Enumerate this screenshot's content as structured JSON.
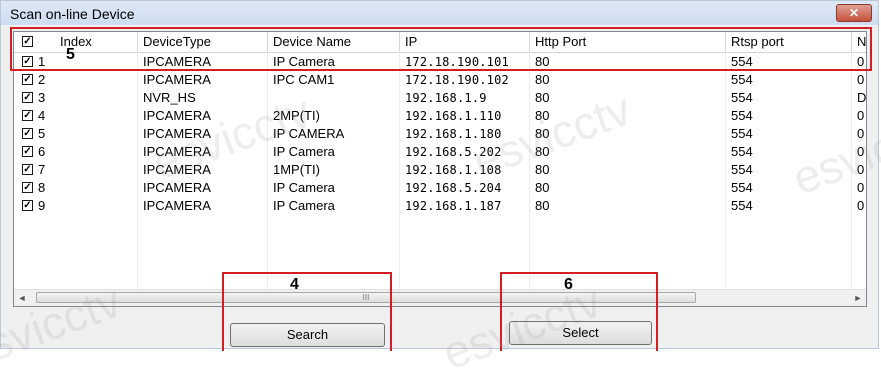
{
  "window": {
    "title": "Scan on-line Device",
    "close_glyph": "✕"
  },
  "columns": [
    "Index",
    "DeviceType",
    "Device Name",
    "IP",
    "Http Port",
    "Rtsp port",
    "N"
  ],
  "header_checked": true,
  "rows": [
    {
      "index": "1",
      "type": "IPCAMERA",
      "name": "IP Camera",
      "ip": "172.18.190.101",
      "http": "80",
      "rtsp": "554",
      "n": "0"
    },
    {
      "index": "2",
      "type": "IPCAMERA",
      "name": "IPC CAM1",
      "ip": "172.18.190.102",
      "http": "80",
      "rtsp": "554",
      "n": "0"
    },
    {
      "index": "3",
      "type": "NVR_HS",
      "name": "",
      "ip": "192.168.1.9",
      "http": "80",
      "rtsp": "554",
      "n": "D"
    },
    {
      "index": "4",
      "type": "IPCAMERA",
      "name": "2MP(TI)",
      "ip": "192.168.1.110",
      "http": "80",
      "rtsp": "554",
      "n": "0"
    },
    {
      "index": "5",
      "type": "IPCAMERA",
      "name": "IP CAMERA",
      "ip": "192.168.1.180",
      "http": "80",
      "rtsp": "554",
      "n": "0"
    },
    {
      "index": "6",
      "type": "IPCAMERA",
      "name": "IP Camera",
      "ip": "192.168.5.202",
      "http": "80",
      "rtsp": "554",
      "n": "0"
    },
    {
      "index": "7",
      "type": "IPCAMERA",
      "name": "1MP(TI)",
      "ip": "192.168.1.108",
      "http": "80",
      "rtsp": "554",
      "n": "0"
    },
    {
      "index": "8",
      "type": "IPCAMERA",
      "name": "IP Camera",
      "ip": "192.168.5.204",
      "http": "80",
      "rtsp": "554",
      "n": "0"
    },
    {
      "index": "9",
      "type": "IPCAMERA",
      "name": "IP Camera",
      "ip": "192.168.1.187",
      "http": "80",
      "rtsp": "554",
      "n": "0"
    }
  ],
  "scrollbar": {
    "left_arrow": "◄",
    "right_arrow": "►",
    "thumb_grip": "III"
  },
  "buttons": {
    "search": "Search",
    "select": "Select"
  },
  "callouts": {
    "header_row": "5",
    "search_button": "4",
    "select_button": "6"
  },
  "callout_color": "#d21e24",
  "watermark": "esvicctv",
  "check_glyph": "✓"
}
